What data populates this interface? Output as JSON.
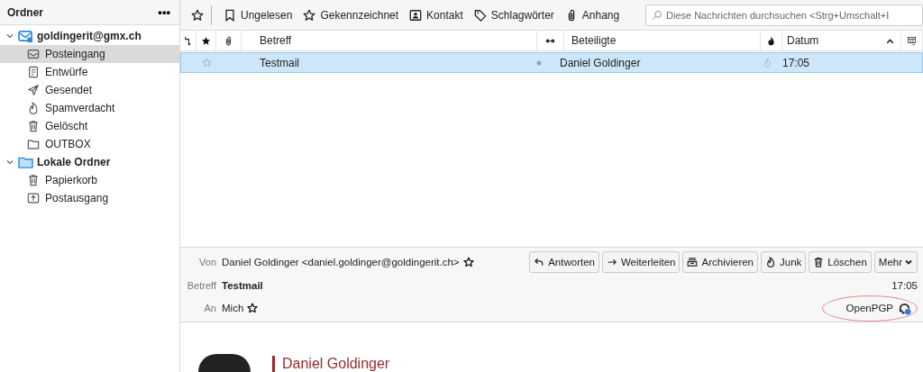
{
  "sidebar": {
    "title": "Ordner",
    "menu": "•••",
    "accounts": [
      {
        "name": "goldingerit@gmx.ch",
        "kind": "mail",
        "expanded": true,
        "folders": [
          {
            "name": "Posteingang",
            "kind": "inbox",
            "selected": true
          },
          {
            "name": "Entwürfe",
            "kind": "drafts",
            "selected": false
          },
          {
            "name": "Gesendet",
            "kind": "sent",
            "selected": false
          },
          {
            "name": "Spamverdacht",
            "kind": "junk",
            "selected": false
          },
          {
            "name": "Gelöscht",
            "kind": "trash",
            "selected": false
          },
          {
            "name": "OUTBOX",
            "kind": "folder",
            "selected": false
          }
        ]
      },
      {
        "name": "Lokale Ordner",
        "kind": "local",
        "expanded": true,
        "folders": [
          {
            "name": "Papierkorb",
            "kind": "trash",
            "selected": false
          },
          {
            "name": "Postausgang",
            "kind": "outbox",
            "selected": false
          }
        ]
      }
    ]
  },
  "toolbar": {
    "filters": [
      {
        "label": "Ungelesen",
        "kind": "unread"
      },
      {
        "label": "Gekennzeichnet",
        "kind": "star"
      },
      {
        "label": "Kontakt",
        "kind": "contact"
      },
      {
        "label": "Schlagwörter",
        "kind": "tag"
      },
      {
        "label": "Anhang",
        "kind": "attachment"
      }
    ],
    "search": {
      "placeholder": "Diese Nachrichten durchsuchen <Strg+Umschalt+I"
    }
  },
  "table": {
    "columns": [
      {
        "label": "Betreff"
      },
      {
        "label": "Beteiligte"
      },
      {
        "label": "Datum"
      }
    ],
    "rows": [
      {
        "subject": "Testmail",
        "correspondent": "Daniel Goldinger",
        "date": "17:05",
        "selected": true,
        "starred": false
      }
    ]
  },
  "message": {
    "from_label": "Von",
    "from": "Daniel Goldinger <daniel.goldinger@goldingerit.ch>",
    "subject_label": "Betreff",
    "subject": "Testmail",
    "to_label": "An",
    "to": "Mich",
    "time": "17:05",
    "security": "OpenPGP",
    "actions": [
      {
        "label": "Antworten",
        "kind": "reply"
      },
      {
        "label": "Weiterleiten",
        "kind": "forward"
      },
      {
        "label": "Archivieren",
        "kind": "archive"
      },
      {
        "label": "Junk",
        "kind": "junk"
      },
      {
        "label": "Löschen",
        "kind": "trash"
      },
      {
        "label": "Mehr",
        "kind": "more"
      }
    ],
    "body_sender": "Daniel Goldinger"
  }
}
